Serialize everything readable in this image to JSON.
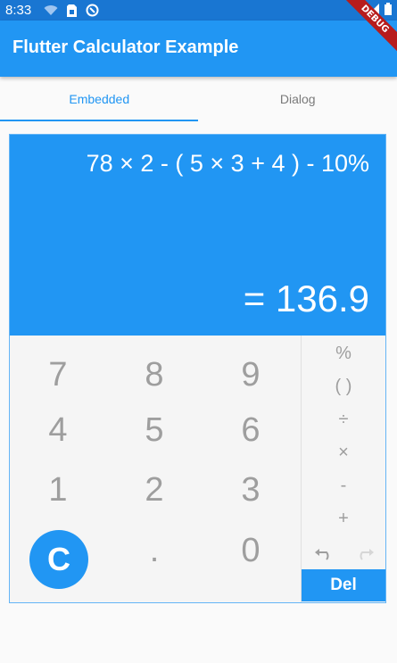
{
  "status_bar": {
    "time": "8:33",
    "icons": [
      "wifi-icon",
      "sim-card-icon",
      "sync-icon",
      "signal-icon",
      "battery-icon"
    ]
  },
  "app_bar": {
    "title": "Flutter Calculator Example"
  },
  "debug_banner": {
    "label": "DEBUG"
  },
  "tabs": [
    {
      "label": "Embedded",
      "active": true
    },
    {
      "label": "Dialog",
      "active": false
    }
  ],
  "calculator": {
    "expression": "78 × 2 - ( 5 × 3 + 4 ) - 10%",
    "result": "= 136.9",
    "keys": {
      "row1": [
        "7",
        "8",
        "9"
      ],
      "row2": [
        "4",
        "5",
        "6"
      ],
      "row3": [
        "1",
        "2",
        "3"
      ],
      "row4": [
        "C",
        ".",
        "0"
      ]
    },
    "operators": [
      "%",
      "( )",
      "÷",
      "×",
      "-",
      "+"
    ],
    "delete_label": "Del"
  },
  "colors": {
    "primary": "#2196f3",
    "primary_dark": "#1976d2",
    "key_text": "#9e9e9e"
  }
}
